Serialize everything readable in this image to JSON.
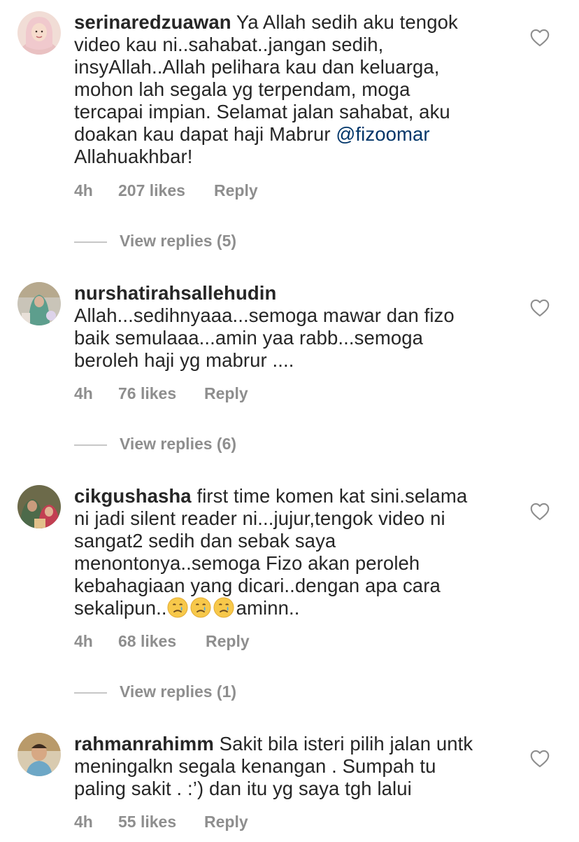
{
  "comments": [
    {
      "username": "serinaredzuawan",
      "first_line_text": "Ya Allah sedih aku tengok",
      "lines": [
        "video kau ni..sahabat..jangan sedih,",
        "insyAllah..Allah pelihara kau dan keluarga,",
        "mohon lah segala yg terpendam, moga",
        "tercapai impian. Selamat jalan sahabat, aku"
      ],
      "last_line_pre": "doakan kau dapat haji Mabrur ",
      "mention": "@fizoomar",
      "tail_line": "Allahuakhbar!",
      "time": "4h",
      "likes": "207 likes",
      "reply": "Reply",
      "view_replies": "View replies (5)"
    },
    {
      "username": "nurshatirahsallehudin",
      "lines": [
        "Allah...sedihnyaaa...semoga mawar dan fizo",
        "baik semulaaa...amin yaa rabb...semoga",
        "beroleh haji yg mabrur ...."
      ],
      "time": "4h",
      "likes": "76 likes",
      "reply": "Reply",
      "view_replies": "View replies (6)"
    },
    {
      "username": "cikgushasha",
      "first_line_text": "first time komen kat sini.selama",
      "lines": [
        "ni jadi silent reader ni...jujur,tengok video ni",
        "sangat2 sedih dan sebak saya",
        "menontonya..semoga Fizo akan peroleh",
        "kebahagiaan yang dicari..dengan apa cara"
      ],
      "last_line_pre": "sekalipun..",
      "emojis": [
        "crying-face",
        "crying-face",
        "crying-face"
      ],
      "last_line_post": "aminn..",
      "time": "4h",
      "likes": "68 likes",
      "reply": "Reply",
      "view_replies": "View replies (1)"
    },
    {
      "username": "rahmanrahimm",
      "first_line_text": "Sakit bila isteri pilih jalan untk",
      "lines": [
        "meningalkn segala kenangan . Sumpah tu",
        "paling sakit . :’) dan itu yg saya tgh lalui"
      ],
      "time": "4h",
      "likes": "55 likes",
      "reply": "Reply"
    }
  ],
  "colors": {
    "text": "#262626",
    "secondary": "#8e8e8e",
    "mention": "#003569",
    "divider": "#c7c7c7"
  },
  "icons": {
    "like": "heart-outline-icon",
    "emoji": "crying-face-emoji"
  }
}
